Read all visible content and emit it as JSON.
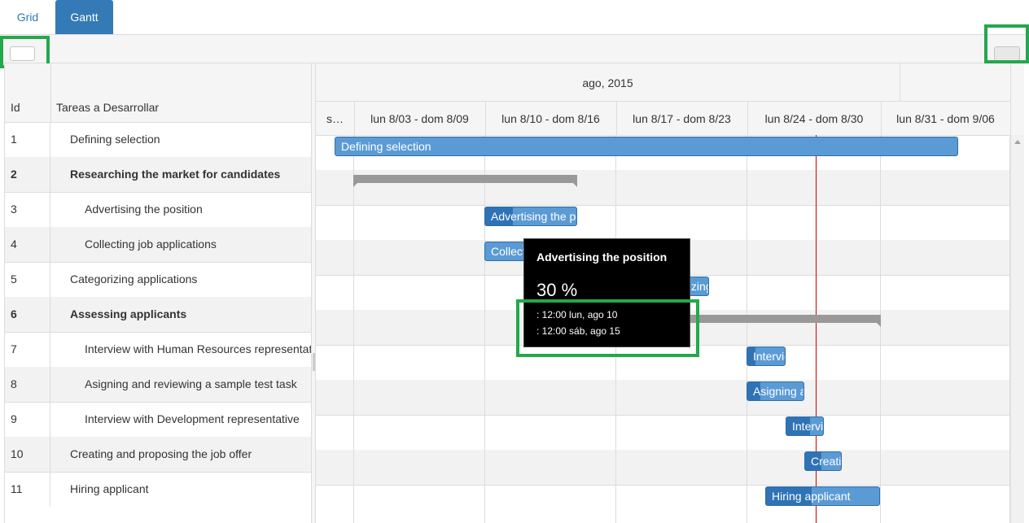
{
  "tabs": {
    "grid": "Grid",
    "gantt": "Gantt"
  },
  "grid": {
    "headers": {
      "id": "Id",
      "name": "Tareas a Desarrollar"
    },
    "rows": [
      {
        "id": "1",
        "name": "Defining selection"
      },
      {
        "id": "2",
        "name": "Researching the market for candidates"
      },
      {
        "id": "3",
        "name": "Advertising the position"
      },
      {
        "id": "4",
        "name": "Collecting job applications"
      },
      {
        "id": "5",
        "name": "Categorizing applications"
      },
      {
        "id": "6",
        "name": "Assessing applicants"
      },
      {
        "id": "7",
        "name": "Interview with Human Resources representative"
      },
      {
        "id": "8",
        "name": "Asigning and reviewing a sample test task"
      },
      {
        "id": "9",
        "name": "Interview with Development representative"
      },
      {
        "id": "10",
        "name": "Creating and proposing the job offer"
      },
      {
        "id": "11",
        "name": "Hiring applicant"
      }
    ]
  },
  "timeline": {
    "month": "ago, 2015",
    "weeks": [
      "s…",
      "lun 8/03 - dom 8/09",
      "lun 8/10 - dom 8/16",
      "lun 8/17 - dom 8/23",
      "lun 8/24 - dom 8/30",
      "lun 8/31 - dom 9/06"
    ],
    "bars": {
      "defining": "Defining selection",
      "advertising": "Advertising the position",
      "collecting": "Collecting job applications",
      "categorizing": "Categorizing applications",
      "interview_hr": "Interview with Human Resources representative",
      "asigning": "Asigning and reviewing a sample test task",
      "interview_dev": "Interview with Development representative",
      "creating": "Creating and proposing the job offer",
      "hiring": "Hiring applicant"
    }
  },
  "tooltip": {
    "title": "Advertising the position",
    "percent": "30 %",
    "start": ": 12:00 lun, ago 10",
    "end": ": 12:00 sáb, ago 15"
  },
  "colors": {
    "accent": "#337ab7",
    "bar": "#5b9bd5",
    "today": "#cc0000",
    "highlight": "#24a84b"
  }
}
